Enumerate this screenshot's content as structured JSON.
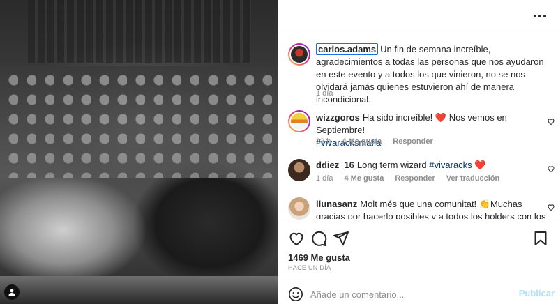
{
  "post": {
    "author": "carlos.adams",
    "caption": "Un fin de semana increíble, agradecimientos a todas las personas que nos ayudaron en este evento y a todos los que vinieron, no se nos olvidará jamás quienes estuvieron ahí de manera incondicional.",
    "caption_age": "1 día",
    "likes": "1469 Me gusta",
    "posted": "HACE UN DÍA"
  },
  "comments": [
    {
      "user": "wizzgoros",
      "text": "Ha sido increíble! ❤️ Nos vemos en Septiembre!",
      "hashtag": "#vivaracksmafia",
      "age": "23 h",
      "likes": "4 Me gusta",
      "reply": "Responder"
    },
    {
      "user": "ddiez_16",
      "text": "Long term wizard",
      "hashtag": "#vivaracks",
      "text_after": "❤️",
      "age": "1 día",
      "likes": "4 Me gusta",
      "reply": "Responder",
      "translate": "Ver traducción"
    },
    {
      "user": "llunasanz",
      "text": "Molt més que una comunitat! 👏Muchas gracias por hacerlo posibles y a todos los holders con los que he"
    }
  ],
  "composer": {
    "placeholder": "Añade un comentario...",
    "post_label": "Publicar"
  },
  "icons": {
    "more": "more-options-icon",
    "like": "heart-icon",
    "comment": "comment-icon",
    "share": "paper-plane-icon",
    "save": "bookmark-icon",
    "emoji": "smiley-icon",
    "tag": "user-tag-icon"
  }
}
